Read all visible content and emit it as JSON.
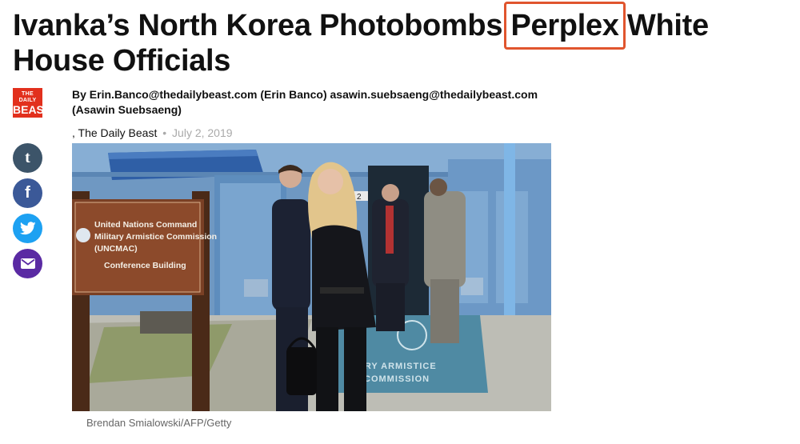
{
  "article": {
    "headline_before": "Ivanka’s North Korea Photobombs ",
    "headline_highlight": "Perplex",
    "headline_after": " White House Officials",
    "byline": "By Erin.Banco@thedailybeast.com (Erin Banco) asawin.suebsaeng@thedailybeast.com (Asawin Suebsaeng)",
    "source_prefix": ",",
    "source": "The Daily Beast",
    "separator": "•",
    "date": "July 2, 2019",
    "photo_credit": "Brendan Smialowski/AFP/Getty"
  },
  "logo": {
    "line1": "THE DAILY",
    "line2": "BEAST"
  },
  "share": [
    {
      "name": "tumblr",
      "icon": "tumblr-icon",
      "glyph": "t"
    },
    {
      "name": "facebook",
      "icon": "facebook-icon",
      "glyph": "f"
    },
    {
      "name": "twitter",
      "icon": "twitter-icon"
    },
    {
      "name": "email",
      "icon": "email-icon"
    }
  ],
  "photo": {
    "sign_lines": [
      "United Nations Command",
      "Military Armistice Commission",
      "(UNCMAC)",
      "Conference Building"
    ],
    "door_number": "2",
    "mat_lines": [
      "TARY ARMISTICE",
      "COMMISSION"
    ]
  },
  "colors": {
    "highlight_box": "#e0552e",
    "logo_red": "#e2301d",
    "tumblr": "#3c5469",
    "facebook": "#3b5998",
    "twitter": "#1da1f2",
    "email": "#5a2aa3",
    "building_blue": "#6a90b8"
  }
}
